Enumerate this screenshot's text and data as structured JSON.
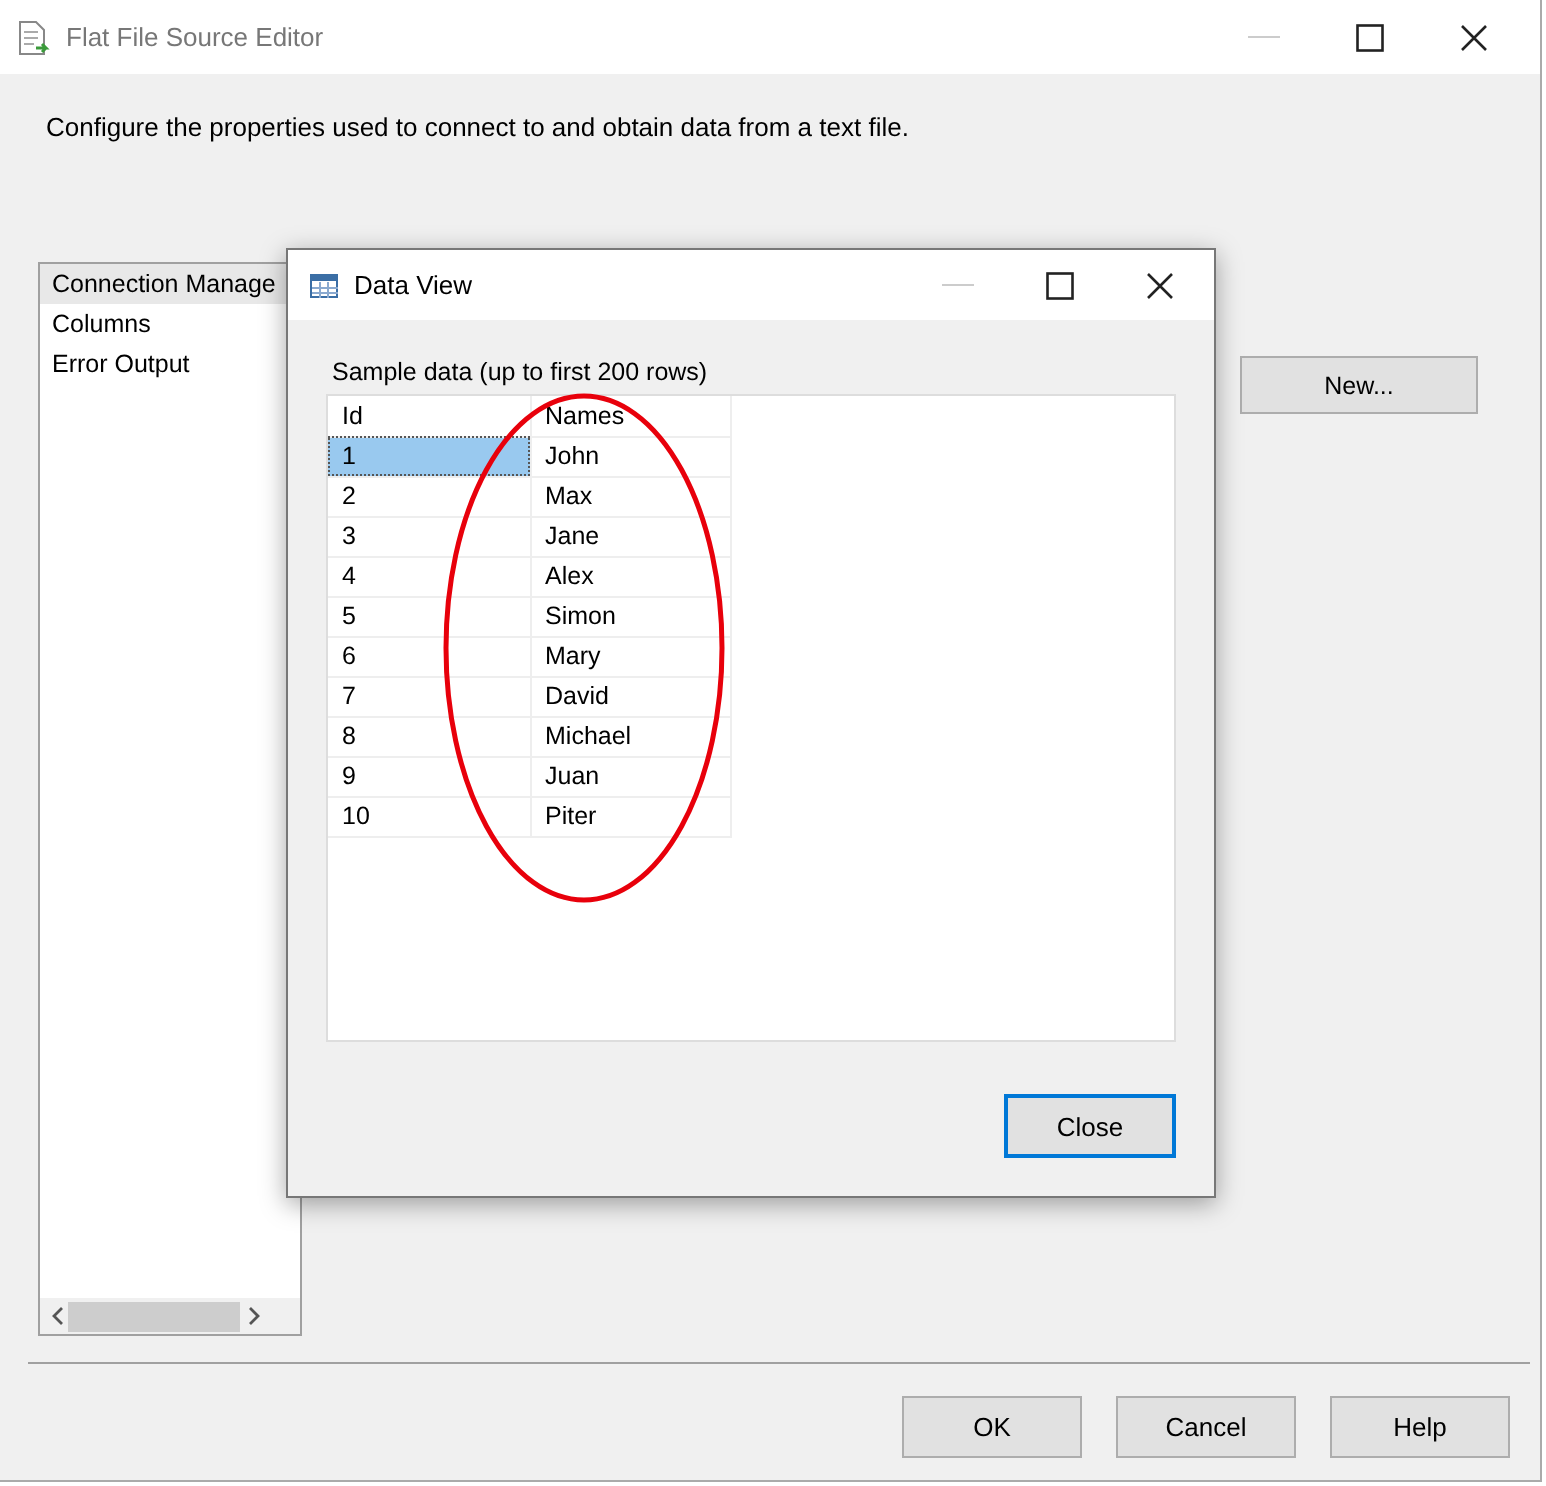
{
  "window": {
    "title": "Flat File Source Editor"
  },
  "description": "Configure the properties used to connect to and obtain data from a text file.",
  "sidebar": {
    "items": [
      {
        "label": "Connection Manage",
        "selected": true
      },
      {
        "label": "Columns",
        "selected": false
      },
      {
        "label": "Error Output",
        "selected": false
      }
    ]
  },
  "new_button": "New...",
  "buttons": [
    "OK",
    "Cancel",
    "Help"
  ],
  "data_view": {
    "title": "Data View",
    "caption": "Sample data (up to first 200 rows)",
    "columns": [
      "Id",
      "Names"
    ],
    "rows": [
      {
        "cells": [
          "1",
          "John"
        ],
        "selected": true
      },
      {
        "cells": [
          "2",
          "Max"
        ],
        "selected": false
      },
      {
        "cells": [
          "3",
          "Jane"
        ],
        "selected": false
      },
      {
        "cells": [
          "4",
          "Alex"
        ],
        "selected": false
      },
      {
        "cells": [
          "5",
          "Simon"
        ],
        "selected": false
      },
      {
        "cells": [
          "6",
          "Mary"
        ],
        "selected": false
      },
      {
        "cells": [
          "7",
          "David"
        ],
        "selected": false
      },
      {
        "cells": [
          "8",
          "Michael"
        ],
        "selected": false
      },
      {
        "cells": [
          "9",
          "Juan"
        ],
        "selected": false
      },
      {
        "cells": [
          "10",
          "Piter"
        ],
        "selected": false
      }
    ],
    "close_button": "Close"
  }
}
